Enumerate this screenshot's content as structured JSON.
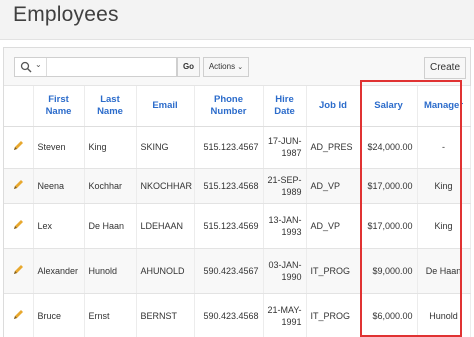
{
  "page": {
    "title": "Employees"
  },
  "toolbar": {
    "search_value": "",
    "go_label": "Go",
    "actions_label": "Actions",
    "create_label": "Create"
  },
  "table": {
    "headers": {
      "first_name": "First Name",
      "last_name": "Last Name",
      "email": "Email",
      "phone": "Phone Number",
      "hire_date": "Hire Date",
      "job_id": "Job Id",
      "salary": "Salary",
      "manager": "Manager"
    },
    "rows": [
      {
        "first_name": "Steven",
        "last_name": "King",
        "email": "SKING",
        "phone": "515.123.4567",
        "hire_date": "17-JUN-1987",
        "job_id": "AD_PRES",
        "salary": "$24,000.00",
        "manager": "-"
      },
      {
        "first_name": "Neena",
        "last_name": "Kochhar",
        "email": "NKOCHHAR",
        "phone": "515.123.4568",
        "hire_date": "21-SEP-1989",
        "job_id": "AD_VP",
        "salary": "$17,000.00",
        "manager": "King"
      },
      {
        "first_name": "Lex",
        "last_name": "De Haan",
        "email": "LDEHAAN",
        "phone": "515.123.4569",
        "hire_date": "13-JAN-1993",
        "job_id": "AD_VP",
        "salary": "$17,000.00",
        "manager": "King"
      },
      {
        "first_name": "Alexander",
        "last_name": "Hunold",
        "email": "AHUNOLD",
        "phone": "590.423.4567",
        "hire_date": "03-JAN-1990",
        "job_id": "IT_PROG",
        "salary": "$9,000.00",
        "manager": "De Haan"
      },
      {
        "first_name": "Bruce",
        "last_name": "Ernst",
        "email": "BERNST",
        "phone": "590.423.4568",
        "hire_date": "21-MAY-1991",
        "job_id": "IT_PROG",
        "salary": "$6,000.00",
        "manager": "Hunold"
      }
    ]
  },
  "colors": {
    "header_link": "#2c6ccb",
    "edit_icon": "#e8a82e",
    "highlight": "#e03232"
  }
}
